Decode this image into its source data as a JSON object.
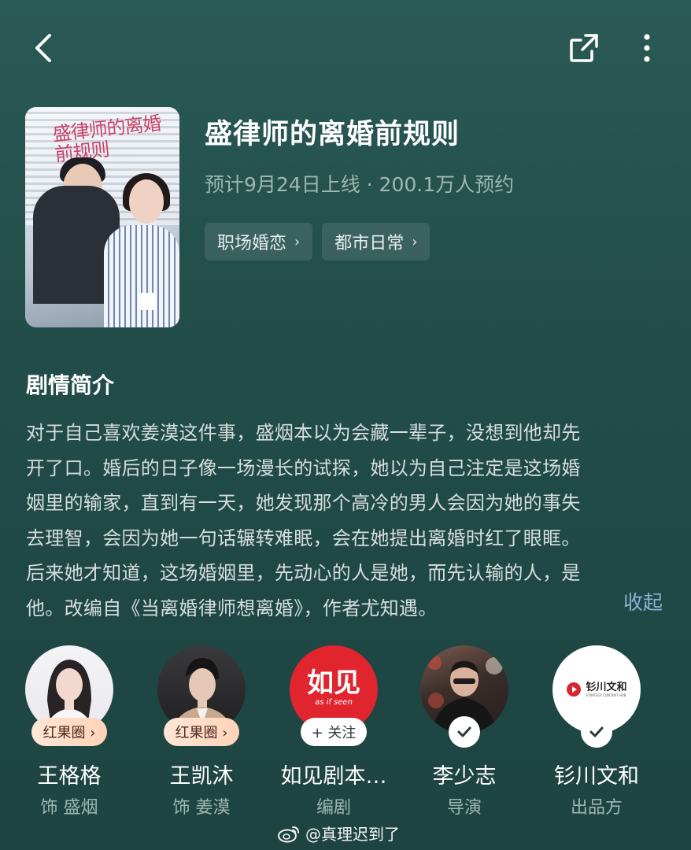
{
  "header": {
    "back_icon": "chevron-left-icon",
    "share_icon": "share-external-icon",
    "more_icon": "more-vertical-icon"
  },
  "drama": {
    "poster_title": "盛律师的离婚前规则",
    "title": "盛律师的离婚前规则",
    "meta": "预计9月24日上线 · 200.1万人预约",
    "tags": [
      {
        "label": "职场婚恋"
      },
      {
        "label": "都市日常"
      }
    ]
  },
  "synopsis": {
    "heading": "剧情简介",
    "lines": [
      "对于自己喜欢姜漠这件事，盛烟本以为会藏一辈子，没想到他却先",
      "开了口。婚后的日子像一场漫长的试探，她以为自己注定是这场婚",
      "姻里的输家，直到有一天，她发现那个高冷的男人会因为她的事失",
      "去理智，会因为她一句话辗转难眠，会在她提出离婚时红了眼眶。",
      "后来她才知道，这场婚姻里，先动心的人是她，而先认输的人，是",
      "他。改编自《当离婚律师想离婚》，作者尤知遇。"
    ],
    "collapse_label": "收起"
  },
  "cast": [
    {
      "name": "王格格",
      "role": "饰 盛烟",
      "badge": "红果圈 ›",
      "badge_type": "hongguo"
    },
    {
      "name": "王凯沐",
      "role": "饰 姜漠",
      "badge": "红果圈 ›",
      "badge_type": "hongguo"
    },
    {
      "name": "如见剧本…",
      "role": "编剧",
      "badge": "+ 关注",
      "badge_type": "follow",
      "avatar_text": "如见",
      "avatar_subtext": "as if seen"
    },
    {
      "name": "李少志",
      "role": "导演",
      "badge_type": "check"
    },
    {
      "name": "钐川文和",
      "role": "出品方",
      "badge_type": "check",
      "avatar_text": "钐川文和",
      "avatar_subtext": "STRATEGY CONTENT HUB"
    }
  ],
  "watermark": {
    "text": "@真理迟到了",
    "icon": "weibo-icon"
  },
  "colors": {
    "background": "#234e4a",
    "accent_link": "#8fb0d8",
    "muted_text": "#9fb7b3",
    "rujian_red": "#e0252e"
  }
}
